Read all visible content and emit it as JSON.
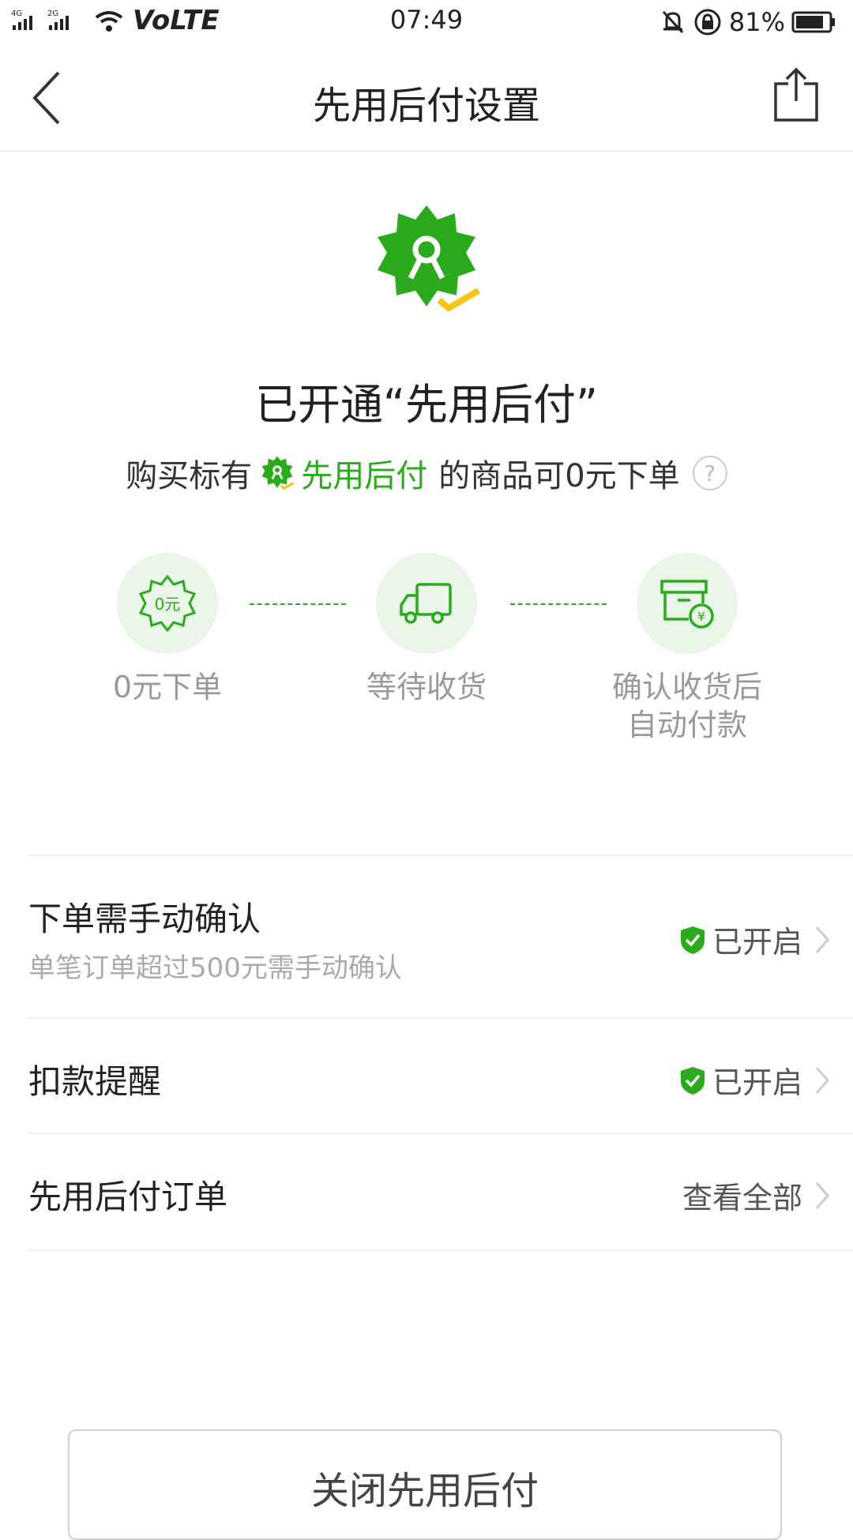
{
  "status_bar": {
    "network_1": "4G",
    "network_2": "2G",
    "volte": "VoLTE",
    "time": "07:49",
    "battery": "81%"
  },
  "nav": {
    "title": "先用后付设置",
    "back_icon": "chevron-left-icon",
    "share_icon": "share-icon"
  },
  "hero": {
    "title": "已开通“先用后付”",
    "desc_prefix": "购买标有",
    "desc_highlight": "先用后付",
    "desc_suffix": "的商品可0元下单",
    "help": "?"
  },
  "steps": [
    {
      "icon_text": "0元",
      "label": "0元下单"
    },
    {
      "label": "等待收货"
    },
    {
      "label_line1": "确认收货后",
      "label_line2": "自动付款",
      "icon_text": "¥"
    }
  ],
  "settings": [
    {
      "title": "下单需手动确认",
      "subtitle": "单笔订单超过500元需手动确认",
      "status": "已开启"
    },
    {
      "title": "扣款提醒",
      "status": "已开启"
    },
    {
      "title": "先用后付订单",
      "action": "查看全部"
    }
  ],
  "colors": {
    "accent": "#2aaa1c",
    "badge_check": "#f5c518"
  },
  "footer": {
    "close_button": "关闭先用后付"
  }
}
